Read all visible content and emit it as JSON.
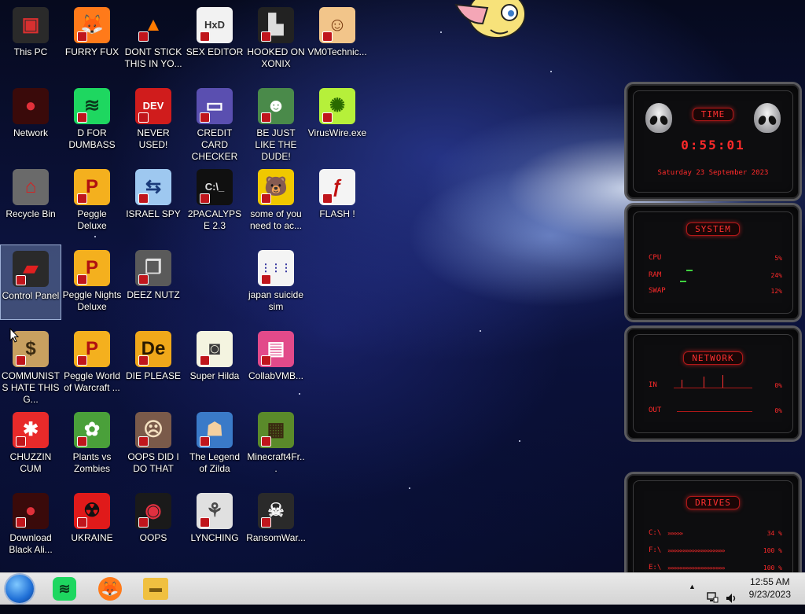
{
  "desktop": {
    "icons": [
      {
        "label": "This PC",
        "glyph": "▣",
        "bg": "#2a2a2a",
        "fg": "#d83030"
      },
      {
        "label": "FURRY FUX",
        "glyph": "🦊",
        "bg": "#ff7a1a",
        "fg": "#ffffff"
      },
      {
        "label": "DONT STICK THIS IN YO...",
        "glyph": "▲",
        "bg": "#00000000",
        "fg": "#ff7b00"
      },
      {
        "label": "SEX EDITOR",
        "glyph": "HxD",
        "bg": "#f2f2f2",
        "fg": "#333333"
      },
      {
        "label": "HOOKED ON XONIX",
        "glyph": "▙",
        "bg": "#222222",
        "fg": "#dddddd"
      },
      {
        "label": "VM0Technic...",
        "glyph": "☺",
        "bg": "#f2c58a",
        "fg": "#7a3b10"
      },
      {
        "label": "Network",
        "glyph": "●",
        "bg": "#3a0a0a",
        "fg": "#e0303a"
      },
      {
        "label": "D FOR DUMBASS",
        "glyph": "≋",
        "bg": "#1ed760",
        "fg": "#0b3b1c"
      },
      {
        "label": "NEVER USED!",
        "glyph": "DEV",
        "bg": "#d01c1c",
        "fg": "#ffffff"
      },
      {
        "label": "CREDIT CARD CHECKER",
        "glyph": "▭",
        "bg": "#5a4fb0",
        "fg": "#ffffff"
      },
      {
        "label": "BE JUST LIKE THE DUDE!",
        "glyph": "☻",
        "bg": "#4a8a4a",
        "fg": "#ffffff"
      },
      {
        "label": "VirusWire.exe",
        "glyph": "✺",
        "bg": "#b6f03a",
        "fg": "#2a6a00"
      },
      {
        "label": "Recycle Bin",
        "glyph": "⌂",
        "bg": "#6a6a6a",
        "fg": "#d82020"
      },
      {
        "label": "Peggle Deluxe",
        "glyph": "P",
        "bg": "#f4b01e",
        "fg": "#b01010"
      },
      {
        "label": "ISRAEL SPY",
        "glyph": "⇆",
        "bg": "#9ec8f0",
        "fg": "#1a3a7a"
      },
      {
        "label": "2PACALYPSE 2.3",
        "glyph": "C:\\_",
        "bg": "#101010",
        "fg": "#e0e0e0"
      },
      {
        "label": "some of you need to ac...",
        "glyph": "🐻",
        "bg": "#f0c800",
        "fg": "#6a3a10"
      },
      {
        "label": "FLASH !",
        "glyph": "ƒ",
        "bg": "#f4f4f4",
        "fg": "#c01010"
      },
      {
        "label": "Control Panel",
        "glyph": "▰",
        "bg": "#2a2a2a",
        "fg": "#e02020"
      },
      {
        "label": "Peggle Nights Deluxe",
        "glyph": "P",
        "bg": "#f4b01e",
        "fg": "#b01010"
      },
      {
        "label": "DEEZ NUTZ",
        "glyph": "❒",
        "bg": "#5a5a5a",
        "fg": "#e0e0e0"
      },
      {
        "label": "japan suicide sim",
        "glyph": "⋮⋮⋮",
        "bg": "#f4f4f4",
        "fg": "#2a2a9a"
      },
      {
        "label": "COMMUNISTS HATE THIS G...",
        "glyph": "$",
        "bg": "#c8a060",
        "fg": "#3a2a10"
      },
      {
        "label": "Peggle World of Warcraft ...",
        "glyph": "P",
        "bg": "#f4b01e",
        "fg": "#b01010"
      },
      {
        "label": "DIE PLEASE",
        "glyph": "De",
        "bg": "#f0a81a",
        "fg": "#2a1a00"
      },
      {
        "label": "Super Hilda",
        "glyph": "◙",
        "bg": "#f4f4e0",
        "fg": "#3a3a3a"
      },
      {
        "label": "CollabVMB...",
        "glyph": "▤",
        "bg": "#e24a8a",
        "fg": "#ffffff"
      },
      {
        "label": "CHUZZIN CUM",
        "glyph": "✱",
        "bg": "#e82a2a",
        "fg": "#ffffff"
      },
      {
        "label": "Plants vs Zombies",
        "glyph": "✿",
        "bg": "#4aa03a",
        "fg": "#ffffff"
      },
      {
        "label": "OOPS DID I DO THAT",
        "glyph": "☹",
        "bg": "#7a5a4a",
        "fg": "#f4e0c0"
      },
      {
        "label": "The Legend of Zilda",
        "glyph": "☗",
        "bg": "#3a7ac8",
        "fg": "#f4d0a0"
      },
      {
        "label": "Minecraft4Fr...",
        "glyph": "▦",
        "bg": "#5a8a2a",
        "fg": "#3a2a10"
      },
      {
        "label": "Download Black Ali...",
        "glyph": "●",
        "bg": "#3a0a0a",
        "fg": "#e0303a"
      },
      {
        "label": "UKRAINE",
        "glyph": "☢",
        "bg": "#e01a1a",
        "fg": "#111111"
      },
      {
        "label": "OOPS",
        "glyph": "◉",
        "bg": "#1a1a1a",
        "fg": "#e03040"
      },
      {
        "label": "LYNCHING",
        "glyph": "⚘",
        "bg": "#e0e0e0",
        "fg": "#4a4a4a"
      },
      {
        "label": "RansomWar...",
        "glyph": "☠",
        "bg": "#2a2a2a",
        "fg": "#f4f4f4"
      }
    ]
  },
  "widgets": {
    "time": {
      "title": "TIME",
      "clock": "0:55:01",
      "date": "Saturday 23 September 2023"
    },
    "system": {
      "title": "SYSTEM",
      "rows": [
        {
          "label": "CPU",
          "value": "5%"
        },
        {
          "label": "RAM",
          "value": "24%"
        },
        {
          "label": "SWAP",
          "value": "12%"
        }
      ]
    },
    "network": {
      "title": "NETWORK",
      "rows": [
        {
          "label": "IN",
          "value": "0%"
        },
        {
          "label": "OUT",
          "value": "0%"
        }
      ]
    },
    "drives": {
      "title": "DRIVES",
      "rows": [
        {
          "label": "C:\\",
          "value": "34 %",
          "arrows": "»»»»»"
        },
        {
          "label": "F:\\",
          "value": "100 %",
          "arrows": "»»»»»»»»»»»»»»»»»»»"
        },
        {
          "label": "E:\\",
          "value": "100 %",
          "arrows": "»»»»»»»»»»»»»»»»»»»"
        }
      ]
    }
  },
  "taskbar": {
    "clock_time": "12:55 AM",
    "clock_date": "9/23/2023",
    "tray_chevron": "▲",
    "pinned": [
      {
        "name": "spotify",
        "glyph": "≋",
        "bg": "#1ed760",
        "fg": "#0b3b1c"
      },
      {
        "name": "firefox",
        "glyph": "🦊",
        "bg": "#ff7a1a",
        "fg": "#ffffff"
      },
      {
        "name": "file-explorer",
        "glyph": "▬",
        "bg": "#f0c040",
        "fg": "#7a5a10"
      }
    ]
  },
  "colors": {
    "widget_red": "#ff2a2a",
    "taskbar_bg": "#e0e0e0",
    "selected_icon": "#a0bee6"
  }
}
